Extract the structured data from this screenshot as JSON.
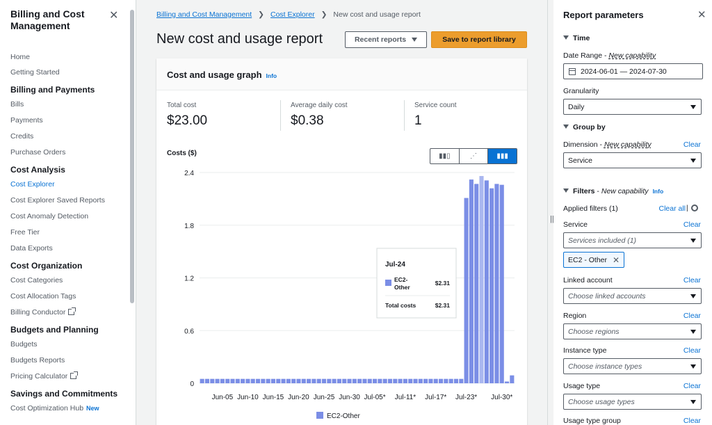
{
  "sidebar": {
    "title": "Billing and Cost Management",
    "close_icon": "close-icon",
    "items": [
      {
        "label": "Home",
        "type": "item"
      },
      {
        "label": "Getting Started",
        "type": "item"
      },
      {
        "label": "Billing and Payments",
        "type": "head"
      },
      {
        "label": "Bills",
        "type": "item"
      },
      {
        "label": "Payments",
        "type": "item"
      },
      {
        "label": "Credits",
        "type": "item"
      },
      {
        "label": "Purchase Orders",
        "type": "item"
      },
      {
        "label": "Cost Analysis",
        "type": "head"
      },
      {
        "label": "Cost Explorer",
        "type": "item",
        "active": true
      },
      {
        "label": "Cost Explorer Saved Reports",
        "type": "item"
      },
      {
        "label": "Cost Anomaly Detection",
        "type": "item"
      },
      {
        "label": "Free Tier",
        "type": "item"
      },
      {
        "label": "Data Exports",
        "type": "item"
      },
      {
        "label": "Cost Organization",
        "type": "head"
      },
      {
        "label": "Cost Categories",
        "type": "item"
      },
      {
        "label": "Cost Allocation Tags",
        "type": "item"
      },
      {
        "label": "Billing Conductor",
        "type": "item",
        "external": true
      },
      {
        "label": "Budgets and Planning",
        "type": "head"
      },
      {
        "label": "Budgets",
        "type": "item"
      },
      {
        "label": "Budgets Reports",
        "type": "item"
      },
      {
        "label": "Pricing Calculator",
        "type": "item",
        "external": true
      },
      {
        "label": "Savings and Commitments",
        "type": "head"
      },
      {
        "label": "Cost Optimization Hub",
        "type": "item",
        "badge": "New"
      }
    ]
  },
  "breadcrumb": {
    "items": [
      "Billing and Cost Management",
      "Cost Explorer"
    ],
    "current": "New cost and usage report"
  },
  "page": {
    "title": "New cost and usage report",
    "recent_reports": "Recent reports",
    "save_button": "Save to report library"
  },
  "graph": {
    "title": "Cost and usage graph",
    "info": "Info",
    "metrics": [
      {
        "label": "Total cost",
        "value": "$23.00"
      },
      {
        "label": "Average daily cost",
        "value": "$0.38"
      },
      {
        "label": "Service count",
        "value": "1"
      }
    ],
    "costs_label": "Costs ($)",
    "chart_type_icons": [
      "bar-chart-icon",
      "line-chart-icon",
      "stacked-bar-chart-icon"
    ],
    "tooltip": {
      "date": "Jul-24",
      "service": "EC2-Other",
      "service_value": "$2.31",
      "total_label": "Total costs",
      "total_value": "$2.31"
    }
  },
  "chart_data": {
    "type": "bar",
    "series": [
      {
        "name": "EC2-Other",
        "color": "#7b8ee6",
        "values": [
          0.05,
          0.05,
          0.05,
          0.05,
          0.05,
          0.05,
          0.05,
          0.05,
          0.05,
          0.05,
          0.05,
          0.05,
          0.05,
          0.05,
          0.05,
          0.05,
          0.05,
          0.05,
          0.05,
          0.05,
          0.05,
          0.05,
          0.05,
          0.05,
          0.05,
          0.05,
          0.05,
          0.05,
          0.05,
          0.05,
          0.05,
          0.05,
          0.05,
          0.05,
          0.05,
          0.05,
          0.05,
          0.05,
          0.05,
          0.05,
          0.05,
          0.05,
          0.05,
          0.05,
          0.05,
          0.05,
          0.05,
          0.05,
          0.05,
          0.05,
          0.05,
          0.05,
          2.11,
          2.32,
          2.27,
          2.36,
          2.31,
          2.22,
          2.27,
          2.26,
          0.02,
          0.09
        ]
      }
    ],
    "x_tick_labels": [
      "Jun-05",
      "Jun-10",
      "Jun-15",
      "Jun-20",
      "Jun-25",
      "Jun-30",
      "Jul-05*",
      "Jul-11*",
      "Jul-17*",
      "Jul-23*",
      "Jul-30*"
    ],
    "x_tick_indices": [
      4,
      9,
      14,
      19,
      24,
      29,
      34,
      40,
      46,
      52,
      59
    ],
    "highlight_index": 55,
    "ylabel": "Costs ($)",
    "yticks": [
      0,
      0.6,
      1.2,
      1.8,
      2.4
    ],
    "ylim": [
      0,
      2.4
    ],
    "grid": true,
    "legend": "bottom-center"
  },
  "panel": {
    "title": "Report parameters",
    "time_section": "Time",
    "date_range_label": "Date Range",
    "new_capability": "New capability",
    "date_range_value": "2024-06-01 — 2024-07-30",
    "granularity_label": "Granularity",
    "granularity_value": "Daily",
    "group_by_section": "Group by",
    "dimension_label": "Dimension",
    "dimension_value": "Service",
    "clear": "Clear",
    "filters_section": "Filters",
    "info": "Info",
    "applied_filters": "Applied filters (1)",
    "clear_all": "Clear all",
    "service_label": "Service",
    "service_value": "Services included (1)",
    "service_token": "EC2 - Other",
    "linked_account_label": "Linked account",
    "linked_account_ph": "Choose linked accounts",
    "region_label": "Region",
    "region_ph": "Choose regions",
    "instance_type_label": "Instance type",
    "instance_type_ph": "Choose instance types",
    "usage_type_label": "Usage type",
    "usage_type_ph": "Choose usage types",
    "usage_type_group_label": "Usage type group"
  }
}
